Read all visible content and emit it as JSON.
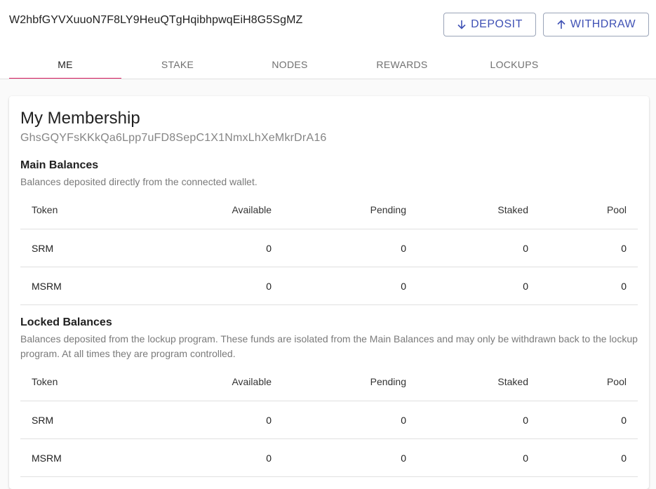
{
  "header": {
    "wallet_address": "W2hbfGYVXuuoN7F8LY9HeuQTgHqibhpwqEiH8G5SgMZ",
    "deposit_label": "DEPOSIT",
    "withdraw_label": "WITHDRAW"
  },
  "tabs": [
    {
      "label": "ME",
      "active": true
    },
    {
      "label": "STAKE",
      "active": false
    },
    {
      "label": "NODES",
      "active": false
    },
    {
      "label": "REWARDS",
      "active": false
    },
    {
      "label": "LOCKUPS",
      "active": false
    }
  ],
  "membership": {
    "title": "My Membership",
    "address": "GhsGQYFsKKkQa6Lpp7uFD8SepC1X1NmxLhXeMkrDrA16"
  },
  "main_balances": {
    "title": "Main Balances",
    "description": "Balances deposited directly from the connected wallet.",
    "columns": [
      "Token",
      "Available",
      "Pending",
      "Staked",
      "Pool"
    ],
    "rows": [
      [
        "SRM",
        "0",
        "0",
        "0",
        "0"
      ],
      [
        "MSRM",
        "0",
        "0",
        "0",
        "0"
      ]
    ]
  },
  "locked_balances": {
    "title": "Locked Balances",
    "description": "Balances deposited from the lockup program. These funds are isolated from the Main Balances and may only be withdrawn back to the lockup program. At all times they are program controlled.",
    "columns": [
      "Token",
      "Available",
      "Pending",
      "Staked",
      "Pool"
    ],
    "rows": [
      [
        "SRM",
        "0",
        "0",
        "0",
        "0"
      ],
      [
        "MSRM",
        "0",
        "0",
        "0",
        "0"
      ]
    ]
  },
  "colors": {
    "accent": "#3f51b5",
    "tab_indicator": "#d81b60"
  },
  "icons": {
    "deposit": "arrow-down-icon",
    "withdraw": "arrow-up-icon"
  }
}
